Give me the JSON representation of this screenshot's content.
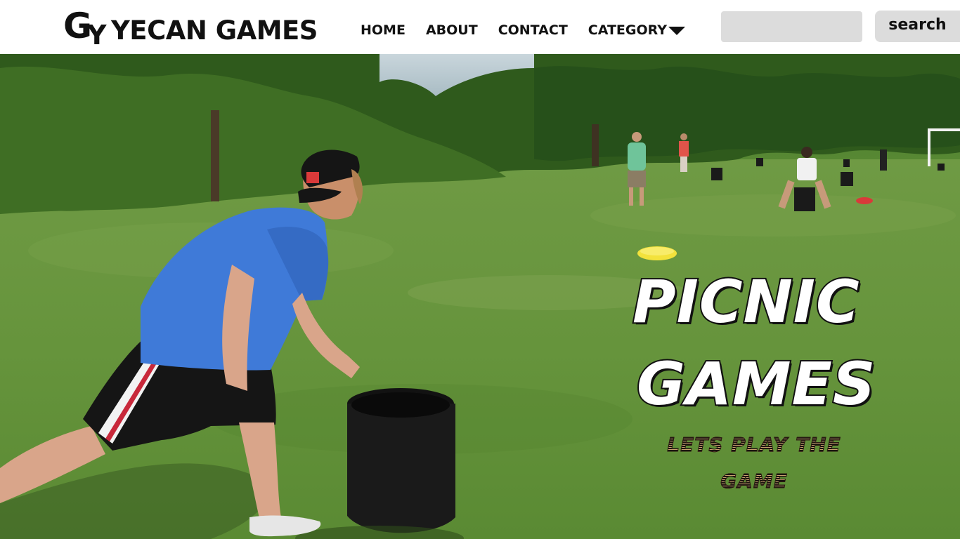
{
  "site": {
    "logo": {
      "mark_letter_1": "G",
      "mark_letter_2": "Y",
      "text": "YECAN GAMES"
    }
  },
  "nav": {
    "items": [
      {
        "label": "HOME"
      },
      {
        "label": "ABOUT"
      },
      {
        "label": "CONTACT"
      },
      {
        "label": "CATEGORY",
        "icon": "caret-down-icon"
      }
    ]
  },
  "search": {
    "value": "",
    "placeholder": "",
    "button_label": "search"
  },
  "hero": {
    "title_line_1": "PICNIC",
    "title_line_2": "GAMES",
    "tagline_line_1": "LETS PLAY THE",
    "tagline_line_2": "GAME",
    "image": "people-playing-frisbee-bucket-game-on-grass-field"
  },
  "colors": {
    "header_bg": "#ffffff",
    "text_dark": "#111111",
    "search_bg": "#dcdcdc",
    "title_fill": "#ffffff",
    "title_stroke": "#111111",
    "grass": "#5f8f35"
  }
}
